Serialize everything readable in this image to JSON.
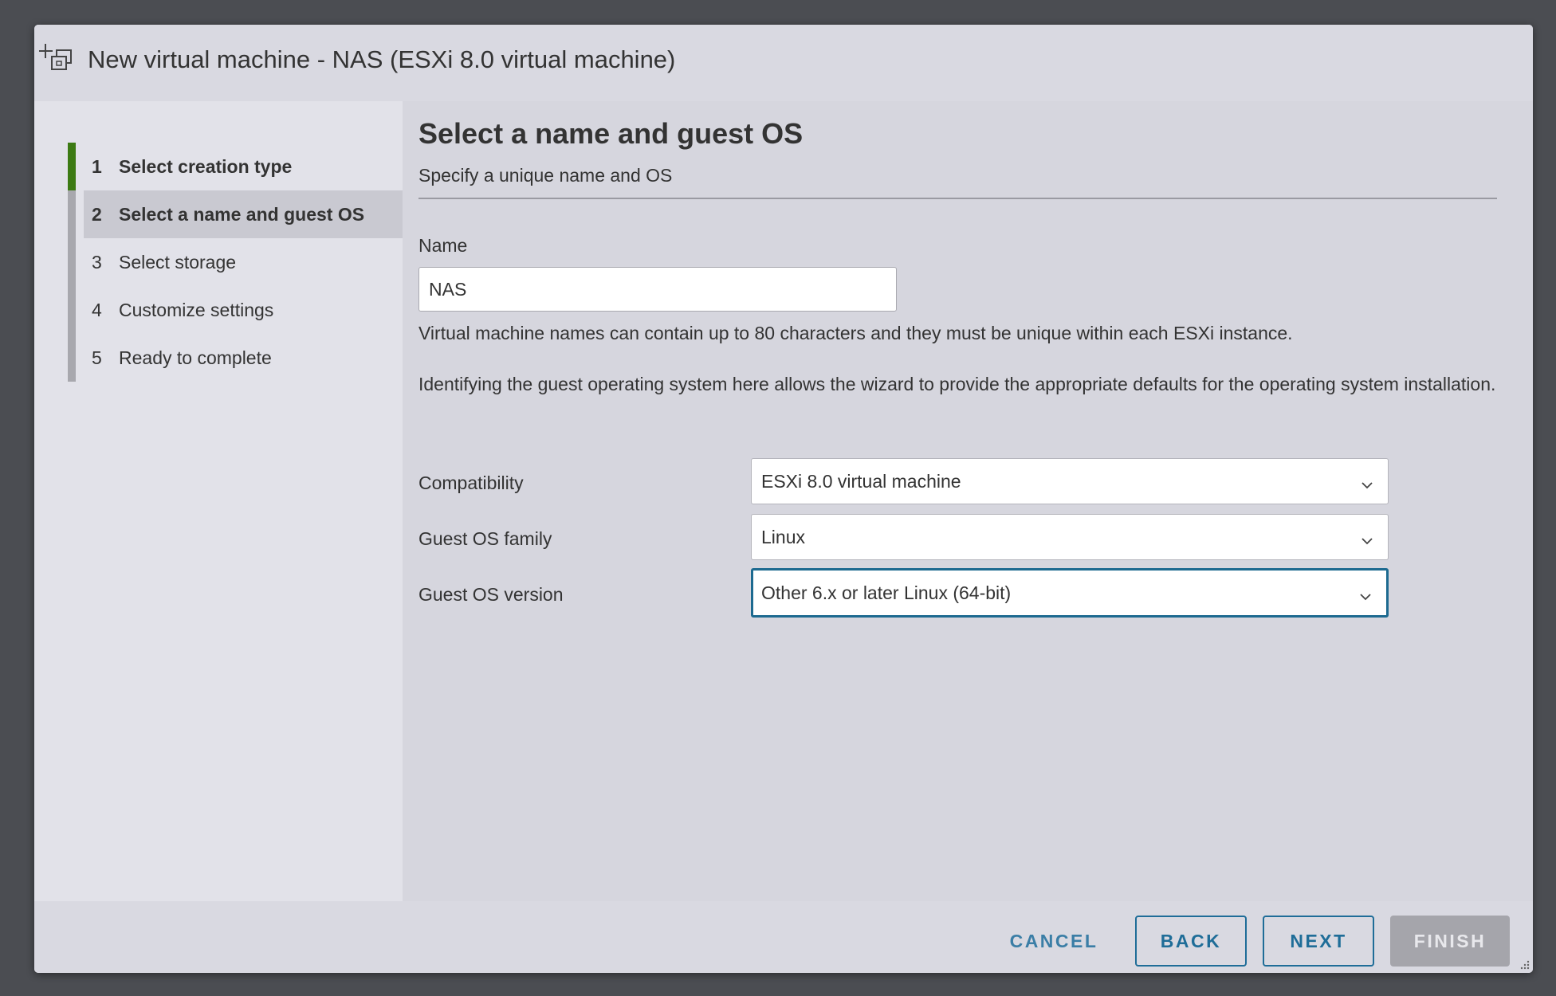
{
  "window": {
    "title": "New virtual machine - NAS (ESXi 8.0 virtual machine)",
    "icon": "new-vm-icon"
  },
  "steps": [
    {
      "num": "1",
      "label": "Select creation type",
      "state": "completed"
    },
    {
      "num": "2",
      "label": "Select a name and guest OS",
      "state": "current"
    },
    {
      "num": "3",
      "label": "Select storage",
      "state": "pending"
    },
    {
      "num": "4",
      "label": "Customize settings",
      "state": "pending"
    },
    {
      "num": "5",
      "label": "Ready to complete",
      "state": "pending"
    }
  ],
  "main": {
    "title": "Select a name and guest OS",
    "subtitle": "Specify a unique name and OS",
    "name_label": "Name",
    "name_value": "NAS",
    "name_help": "Virtual machine names can contain up to 80 characters and they must be unique within each ESXi instance.",
    "os_help": "Identifying the guest operating system here allows the wizard to provide the appropriate defaults for the operating system installation.",
    "compatibility_label": "Compatibility",
    "compatibility_value": "ESXi 8.0 virtual machine",
    "os_family_label": "Guest OS family",
    "os_family_value": "Linux",
    "os_version_label": "Guest OS version",
    "os_version_value": "Other 6.x or later Linux (64-bit)"
  },
  "footer": {
    "cancel": "CANCEL",
    "back": "BACK",
    "next": "NEXT",
    "finish": "FINISH"
  },
  "colors": {
    "accent": "#1f6d98",
    "completed_step": "#3c7a13",
    "disabled_button": "#a5a5ab"
  }
}
